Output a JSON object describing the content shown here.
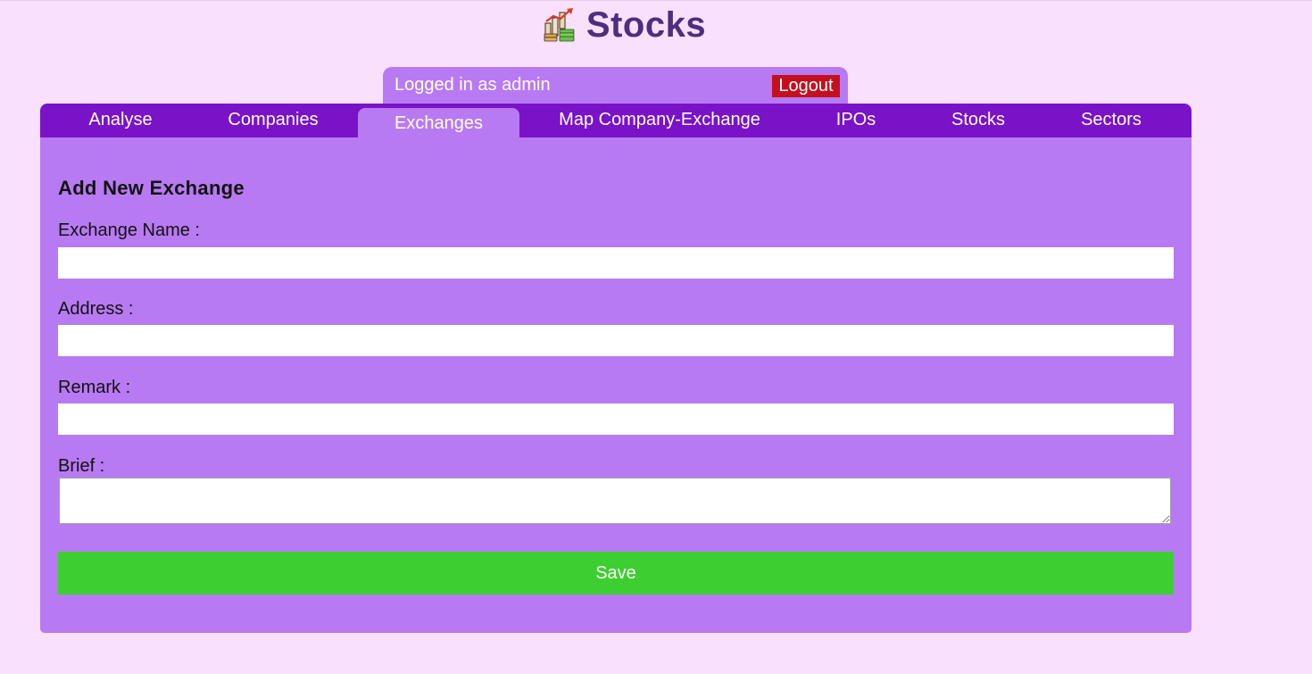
{
  "header": {
    "title": "Stocks",
    "logo_icon": "stock-market-icon"
  },
  "login": {
    "text": "Logged in as admin",
    "logout_label": "Logout"
  },
  "tabs": {
    "analyse": "Analyse",
    "companies": "Companies",
    "exchanges": "Exchanges",
    "map_company_exchange": "Map Company-Exchange",
    "ipos": "IPOs",
    "stocks": "Stocks",
    "sectors": "Sectors",
    "active": "Exchanges"
  },
  "form": {
    "title": "Add New Exchange",
    "exchange_name_label": "Exchange Name :",
    "exchange_name_value": "",
    "address_label": "Address :",
    "address_value": "",
    "remark_label": "Remark :",
    "remark_value": "",
    "brief_label": "Brief :",
    "brief_value": "",
    "save_label": "Save"
  },
  "colors": {
    "page_background": "#f9e0fd",
    "title": "#4f2d7f",
    "tabbar": "#7a12c8",
    "panel": "#b87af2",
    "logout": "#c4101e",
    "save": "#3dcf31"
  }
}
